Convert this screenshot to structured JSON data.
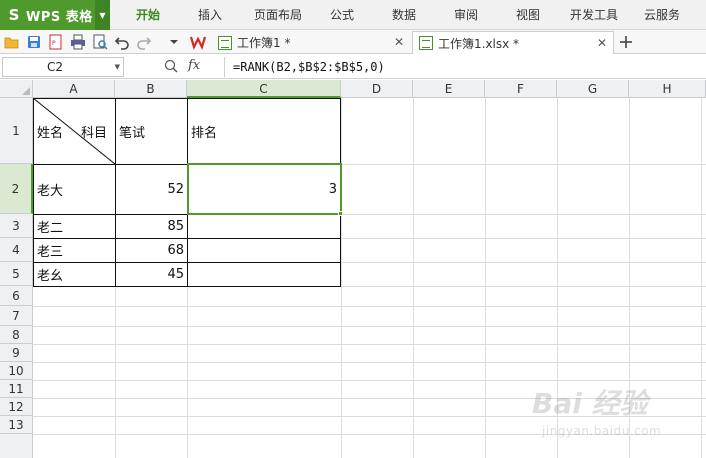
{
  "app": {
    "name": "WPS 表格"
  },
  "menu": {
    "items": [
      "开始",
      "插入",
      "页面布局",
      "公式",
      "数据",
      "审阅",
      "视图",
      "开发工具",
      "云服务"
    ],
    "active_index": 0
  },
  "tabs": [
    {
      "label": "工作簿1 *",
      "active": false
    },
    {
      "label": "工作簿1.xlsx *",
      "active": true
    }
  ],
  "formula_bar": {
    "name_box": "C2",
    "fx_label": "fx",
    "formula": "=RANK(B2,$B$2:$B$5,0)"
  },
  "columns": [
    "A",
    "B",
    "C",
    "D",
    "E",
    "F",
    "G",
    "H"
  ],
  "selected_column": "C",
  "rows": [
    "1",
    "2",
    "3",
    "4",
    "5",
    "6",
    "7",
    "8",
    "9",
    "10",
    "11",
    "12",
    "13"
  ],
  "selected_row": "2",
  "cells": {
    "a1_left": "姓名",
    "a1_right": "科目",
    "b1": "笔试",
    "c1": "排名",
    "a2": "老大",
    "b2": "52",
    "c2": "3",
    "a3": "老二",
    "b3": "85",
    "a4": "老三",
    "b4": "68",
    "a5": "老幺",
    "b5": "45"
  },
  "watermark": {
    "text": "Bai 经验",
    "sub": "jingyan.baidu.com"
  },
  "colors": {
    "accent": "#4e9a2c",
    "header_bg": "#eef0f3",
    "selected_header_bg": "#dbe8d2"
  },
  "icons": [
    "open-folder-icon",
    "save-icon",
    "pdf-export-icon",
    "print-icon",
    "print-preview-icon",
    "undo-icon",
    "redo-icon",
    "dropdown-icon",
    "wps-logo-icon",
    "document-icon",
    "close-icon",
    "add-tab-icon",
    "zoom-formula-icon"
  ]
}
